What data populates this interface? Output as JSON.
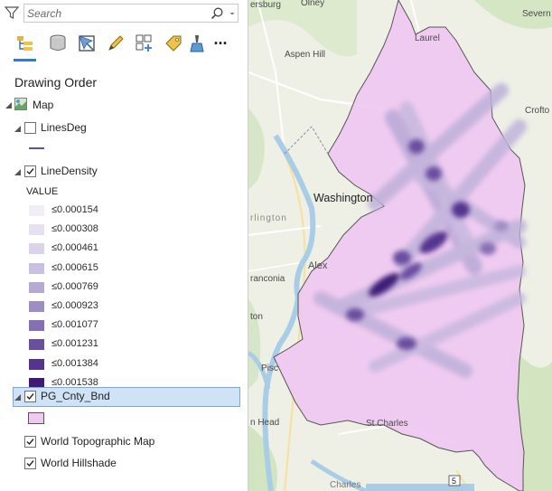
{
  "search": {
    "placeholder": "Search"
  },
  "toolbar": {
    "icons": [
      "list-by-drawing-order-icon",
      "list-by-data-source-icon",
      "list-by-selection-icon",
      "list-by-editing-icon",
      "list-by-snapping-icon",
      "list-by-labeling-icon",
      "list-by-perspective-icon",
      "more-options-icon"
    ],
    "more_label": "..."
  },
  "panel": {
    "title": "Drawing Order"
  },
  "layers": {
    "map": {
      "label": "Map"
    },
    "lines_deg": {
      "label": "LinesDeg",
      "checked": false,
      "symbol_color": "#5a4fb8"
    },
    "line_density": {
      "label": "LineDensity",
      "checked": true,
      "legend_heading": "VALUE",
      "classes": [
        {
          "label": "≤0.000154",
          "color": "#f1eef6"
        },
        {
          "label": "≤0.000308",
          "color": "#e6e1ef"
        },
        {
          "label": "≤0.000461",
          "color": "#dad3ea"
        },
        {
          "label": "≤0.000615",
          "color": "#c9bfe0"
        },
        {
          "label": "≤0.000769",
          "color": "#b6a9d4"
        },
        {
          "label": "≤0.000923",
          "color": "#9e8dc4"
        },
        {
          "label": "≤0.001077",
          "color": "#8670b3"
        },
        {
          "label": "≤0.001231",
          "color": "#6a4ea0"
        },
        {
          "label": "≤0.001384",
          "color": "#55348f"
        },
        {
          "label": "≤0.001538",
          "color": "#3f1a78"
        }
      ]
    },
    "pg_cnty_bnd": {
      "label": "PG_Cnty_Bnd",
      "checked": true,
      "fill_color": "#f0c8f2"
    },
    "world_topo": {
      "label": "World Topographic Map",
      "checked": true
    },
    "world_hillshade": {
      "label": "World Hillshade",
      "checked": true
    }
  },
  "map_labels": {
    "dunsburg": "ersburg",
    "olney": "Olney",
    "severn": "Severn",
    "laurel": "Laurel",
    "aspen_hill": "Aspen Hill",
    "crofton": "Crofto",
    "washington": "Washington",
    "arlington": "rlington",
    "alexandria": "Alex",
    "franconia": "ranconia",
    "piscataway": "Pisc",
    "fort_wash": "ton",
    "mason_neck": "n Head",
    "st_charles": "St Charles",
    "charles": "Charles",
    "route": "5"
  }
}
